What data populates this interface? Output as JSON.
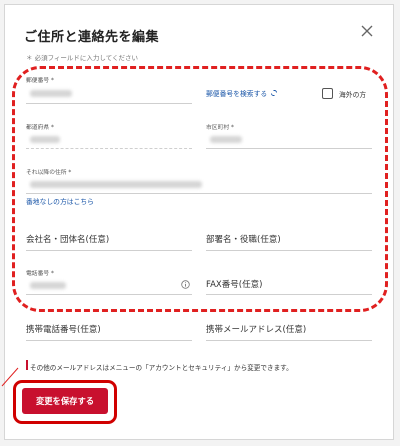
{
  "dialog": {
    "title": "ご住所と連絡先を編集",
    "close_icon": "close-icon",
    "required_note": "＊ 必須フィールドに入力してください"
  },
  "form": {
    "postal_label": "郵便番号 *",
    "postal_search_link": "郵便番号を検索する",
    "postal_search_icon": "link-icon",
    "overseas_label": "海外の方",
    "overseas_checked": false,
    "prefecture_label": "都道府県 *",
    "city_label": "市区町村 *",
    "address_label": "それ以降の住所 *",
    "no_house_number_link": "番地なしの方はこちら",
    "company_placeholder": "会社名・団体名(任意)",
    "department_placeholder": "部署名・役職(任意)",
    "phone_label": "電話番号 *",
    "phone_info_icon": "info-icon",
    "fax_placeholder": "FAX番号(任意)",
    "mobile_phone_placeholder": "携帯電話番号(任意)",
    "mobile_email_placeholder": "携帯メールアドレス(任意)"
  },
  "note": "その他のメールアドレスはメニューの「アカウントとセキュリティ」から変更できます。",
  "save_button_label": "変更を保存する",
  "colors": {
    "accent": "#c8102e",
    "highlight": "#e02020",
    "link": "#1a56a8"
  }
}
